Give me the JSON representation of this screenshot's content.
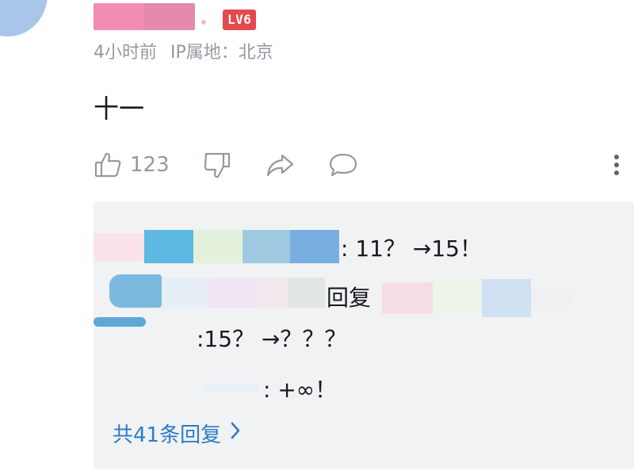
{
  "comment": {
    "level_badge": "LV6",
    "time": "4小时前",
    "ip_location": "IP属地：北京",
    "text": "十一",
    "likes": "123"
  },
  "replies": [
    {
      "text": ": 11？ →15！"
    },
    {
      "reply_label": "回复"
    },
    {
      "text": ":15？ →？？？"
    },
    {
      "text": ": +∞！"
    }
  ],
  "view_all": "共41条回复",
  "icons": {
    "like": "thumbs-up-icon",
    "dislike": "thumbs-down-icon",
    "share": "share-icon",
    "reply": "comment-icon",
    "more": "more-vertical-icon",
    "chevron": "chevron-right-icon"
  },
  "colors": {
    "badge": "#e5484d",
    "link": "#2c7cc7",
    "meta": "#9499a0",
    "panel": "#f1f2f3"
  }
}
